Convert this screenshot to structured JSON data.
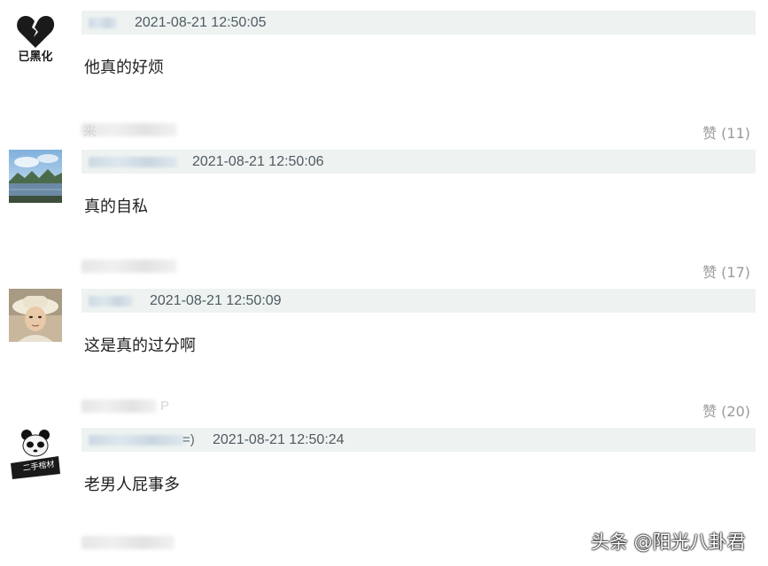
{
  "comments": [
    {
      "timestamp": "2021-08-21 12:50:05",
      "username_suffix": "",
      "content": "他真的好烦",
      "avatar": {
        "icon": "broken-heart-icon",
        "text": "已黑化"
      },
      "like_label": "赞 (11)",
      "footer_tail": "来"
    },
    {
      "timestamp": "2021-08-21 12:50:06",
      "username_suffix": "",
      "content": "真的自私",
      "avatar": {
        "icon": "landscape-photo"
      },
      "like_label": "赞 (17)",
      "footer_tail": ""
    },
    {
      "timestamp": "2021-08-21 12:50:09",
      "username_suffix": "",
      "content": "这是真的过分啊",
      "avatar": {
        "icon": "person-hat-photo"
      },
      "like_label": "赞 (20)",
      "footer_tail": "P"
    },
    {
      "timestamp": "2021-08-21 12:50:24",
      "username_suffix": "=)",
      "content": "老男人屁事多",
      "avatar": {
        "icon": "panda-meme-icon",
        "text": "二手棺材"
      },
      "like_label": "",
      "footer_tail": ""
    }
  ],
  "watermark": "头条 @阳光八卦君",
  "colors": {
    "meta_bar": "#eef3f1",
    "like_text": "#9a9a9a",
    "content_text": "#1f1f1f"
  }
}
